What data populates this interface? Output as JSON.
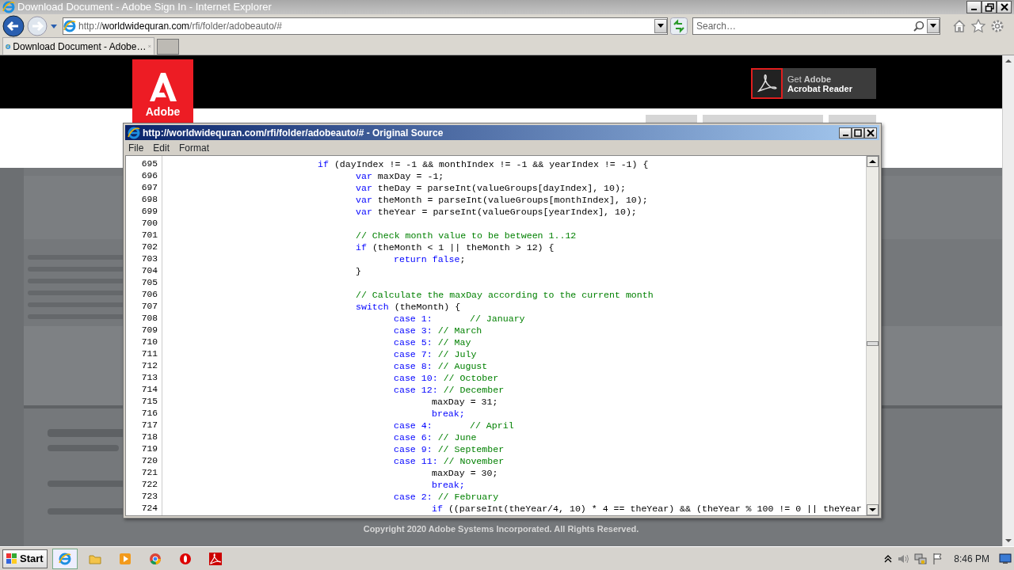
{
  "browser": {
    "title": "Download Document - Adobe Sign In - Internet Explorer",
    "address": {
      "scheme": "http://",
      "host": "worldwidequran.com",
      "path": "/rfi/folder/adobeauto/#"
    },
    "search": {
      "placeholder": "Search…"
    },
    "tabs": [
      {
        "label": "Download Document - Adobe…",
        "selected": true
      }
    ]
  },
  "page": {
    "logo_text": "Adobe",
    "reader_button": {
      "line_1": "Get **Adobe**",
      "line_2": "Acrobat Reader"
    },
    "copyright": "Copyright 2020 Adobe Systems Incorporated. All Rights Reserved."
  },
  "source_window": {
    "title": "http://worldwidequran.com/rfi/folder/adobeauto/# - Original Source",
    "menu": [
      "File",
      "Edit",
      "Format"
    ],
    "lines": [
      {
        "number": "695",
        "segments": [
          {
            "kind": "keyword",
            "text": "\t\t\t\tif"
          },
          {
            "kind": "plain",
            "text": " (dayIndex != -1 && monthIndex != -1 && yearIndex != -1) {"
          }
        ]
      },
      {
        "number": "696",
        "segments": [
          {
            "kind": "keyword",
            "text": "\t\t\t\t\tvar"
          },
          {
            "kind": "plain",
            "text": " maxDay = -1;"
          }
        ]
      },
      {
        "number": "697",
        "segments": [
          {
            "kind": "keyword",
            "text": "\t\t\t\t\tvar"
          },
          {
            "kind": "plain",
            "text": " theDay = parseInt(valueGroups[dayIndex], 10);"
          }
        ]
      },
      {
        "number": "698",
        "segments": [
          {
            "kind": "keyword",
            "text": "\t\t\t\t\tvar"
          },
          {
            "kind": "plain",
            "text": " theMonth = parseInt(valueGroups[monthIndex], 10);"
          }
        ]
      },
      {
        "number": "699",
        "segments": [
          {
            "kind": "keyword",
            "text": "\t\t\t\t\tvar"
          },
          {
            "kind": "plain",
            "text": " theYear = parseInt(valueGroups[yearIndex], 10);"
          }
        ]
      },
      {
        "number": "700"
      },
      {
        "number": "701",
        "segments": [
          {
            "kind": "comment",
            "text": "\t\t\t\t\t// Check month value to be between 1..12"
          }
        ]
      },
      {
        "number": "702",
        "segments": [
          {
            "kind": "keyword",
            "text": "\t\t\t\t\tif"
          },
          {
            "kind": "plain",
            "text": " (theMonth < 1 || theMonth > 12) {"
          }
        ]
      },
      {
        "number": "703",
        "segments": [
          {
            "kind": "keyword",
            "text": "\t\t\t\t\t\treturn false"
          },
          {
            "kind": "plain",
            "text": ";"
          }
        ]
      },
      {
        "number": "704",
        "segments": [
          {
            "kind": "plain",
            "text": "\t\t\t\t\t}"
          }
        ]
      },
      {
        "number": "705"
      },
      {
        "number": "706",
        "segments": [
          {
            "kind": "comment",
            "text": "\t\t\t\t\t// Calculate the maxDay according to the current month"
          }
        ]
      },
      {
        "number": "707",
        "segments": [
          {
            "kind": "keyword",
            "text": "\t\t\t\t\tswitch"
          },
          {
            "kind": "plain",
            "text": " (theMonth) {"
          }
        ]
      },
      {
        "number": "708",
        "segments": [
          {
            "kind": "keyword",
            "text": "\t\t\t\t\t\tcase 1:"
          },
          {
            "kind": "comment",
            "text": "\t// January"
          }
        ]
      },
      {
        "number": "709",
        "segments": [
          {
            "kind": "keyword",
            "text": "\t\t\t\t\t\tcase 3:"
          },
          {
            "kind": "comment",
            "text": " // March"
          }
        ]
      },
      {
        "number": "710",
        "segments": [
          {
            "kind": "keyword",
            "text": "\t\t\t\t\t\tcase 5:"
          },
          {
            "kind": "comment",
            "text": " // May"
          }
        ]
      },
      {
        "number": "711",
        "segments": [
          {
            "kind": "keyword",
            "text": "\t\t\t\t\t\tcase 7:"
          },
          {
            "kind": "comment",
            "text": " // July"
          }
        ]
      },
      {
        "number": "712",
        "segments": [
          {
            "kind": "keyword",
            "text": "\t\t\t\t\t\tcase 8:"
          },
          {
            "kind": "comment",
            "text": " // August"
          }
        ]
      },
      {
        "number": "713",
        "segments": [
          {
            "kind": "keyword",
            "text": "\t\t\t\t\t\tcase 10:"
          },
          {
            "kind": "comment",
            "text": " // October"
          }
        ]
      },
      {
        "number": "714",
        "segments": [
          {
            "kind": "keyword",
            "text": "\t\t\t\t\t\tcase 12:"
          },
          {
            "kind": "comment",
            "text": " // December"
          }
        ]
      },
      {
        "number": "715",
        "segments": [
          {
            "kind": "plain",
            "text": "\t\t\t\t\t\t\tmaxDay = 31;"
          }
        ]
      },
      {
        "number": "716",
        "segments": [
          {
            "kind": "keyword",
            "text": "\t\t\t\t\t\t\tbreak;"
          }
        ]
      },
      {
        "number": "717",
        "segments": [
          {
            "kind": "keyword",
            "text": "\t\t\t\t\t\tcase 4:"
          },
          {
            "kind": "comment",
            "text": "\t// April"
          }
        ]
      },
      {
        "number": "718",
        "segments": [
          {
            "kind": "keyword",
            "text": "\t\t\t\t\t\tcase 6:"
          },
          {
            "kind": "comment",
            "text": " // June"
          }
        ]
      },
      {
        "number": "719",
        "segments": [
          {
            "kind": "keyword",
            "text": "\t\t\t\t\t\tcase 9:"
          },
          {
            "kind": "comment",
            "text": " // September"
          }
        ]
      },
      {
        "number": "720",
        "segments": [
          {
            "kind": "keyword",
            "text": "\t\t\t\t\t\tcase 11:"
          },
          {
            "kind": "comment",
            "text": " // November"
          }
        ]
      },
      {
        "number": "721",
        "segments": [
          {
            "kind": "plain",
            "text": "\t\t\t\t\t\t\tmaxDay = 30;"
          }
        ]
      },
      {
        "number": "722",
        "segments": [
          {
            "kind": "keyword",
            "text": "\t\t\t\t\t\t\tbreak;"
          }
        ]
      },
      {
        "number": "723",
        "segments": [
          {
            "kind": "keyword",
            "text": "\t\t\t\t\t\tcase 2:"
          },
          {
            "kind": "comment",
            "text": " // February"
          }
        ]
      },
      {
        "number": "724",
        "segments": [
          {
            "kind": "keyword",
            "text": "\t\t\t\t\t\t\tif"
          },
          {
            "kind": "plain",
            "text": " ((parseInt(theYear/4, 10) * 4 == theYear) && (theYear % 100 != 0 || theYear"
          }
        ]
      }
    ]
  },
  "taskbar": {
    "start": "Start",
    "apps": [
      {
        "kind": "ie",
        "selected": true
      },
      {
        "kind": "folder",
        "selected": false
      },
      {
        "kind": "media",
        "selected": false
      },
      {
        "kind": "chrome",
        "selected": false
      },
      {
        "kind": "opera",
        "selected": false
      },
      {
        "kind": "acrobat",
        "selected": false
      }
    ],
    "clock": "8:46 PM"
  }
}
